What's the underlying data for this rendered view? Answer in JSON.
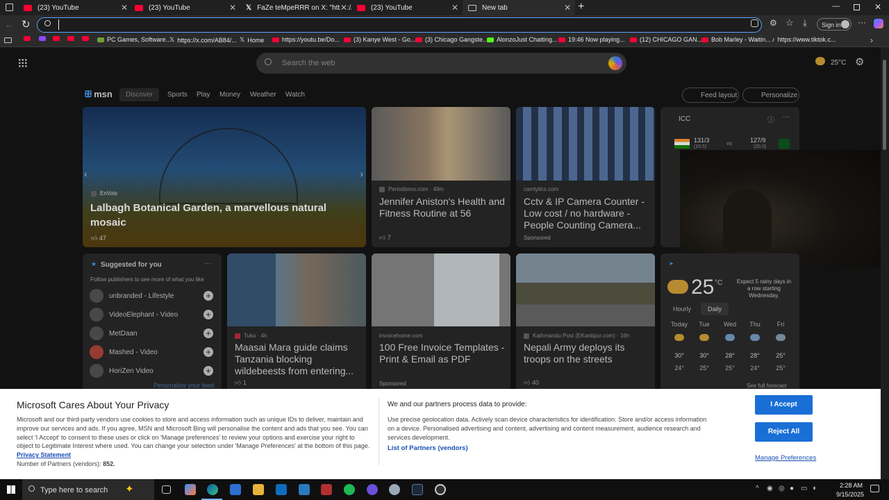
{
  "tabs": [
    {
      "title": "(23) YouTube",
      "icon": "youtube-icon"
    },
    {
      "title": "(23) YouTube",
      "icon": "youtube-icon"
    },
    {
      "title": "FaZe teMpeRRR on X: \"https://t.c",
      "icon": "x-icon"
    },
    {
      "title": "(23) YouTube",
      "icon": "youtube-icon"
    },
    {
      "title": "New tab",
      "icon": "newtab-icon"
    }
  ],
  "address": {
    "value": "",
    "placeholder": ""
  },
  "bookmarks": [
    "PC Games, Software...",
    "https://x.com/AB84/...",
    "Home",
    "https://youtu.be/Do...",
    "(3) Kanye West - Go...",
    "(3) Chicago Gangste...",
    "AlonzoJust Chatting...",
    "19:46 Now playing...",
    "(12) CHICAGO GAN...",
    "Bob Marley - Waitin...",
    "https://www.tiktok.c..."
  ],
  "msn": {
    "search_placeholder": "Search the web",
    "temp": "25°C",
    "logo": "msn",
    "nav": [
      "Discover",
      "Sports",
      "Play",
      "Money",
      "Weather",
      "Watch"
    ],
    "feed_layout": "Feed layout",
    "personalize": "Personalize",
    "hero": {
      "source": "EnVols",
      "title": "Lalbagh Botanical Garden, a marvellous natural mosaic",
      "likes": "47"
    },
    "card1": {
      "source": "Periodismo.com · 49m",
      "title": "Jennifer Aniston's Health and Fitness Routine at 56",
      "likes": "7"
    },
    "card2": {
      "source": "camlytics.com",
      "title": "Cctv & IP Camera Counter - Low cost / no hardware - People Counting Camera...",
      "sponsored": "Sponsored"
    },
    "icc": {
      "label": "ICC",
      "team1_score": "131/3",
      "team1_overs": "(15.5)",
      "vs": "vs",
      "team2_score": "127/9",
      "team2_overs": "(20.0)"
    },
    "suggested": {
      "title": "Suggested for you",
      "subtitle": "Follow publishers to see more of what you like",
      "items": [
        "unbranded - Lifestyle",
        "VideoElephant - Video",
        "MetDaan",
        "Mashed - Video",
        "HoriZen Video"
      ],
      "footer": "Personalize your feed"
    },
    "card3": {
      "source": "Tuko · 4h",
      "title": "Maasai Mara guide claims Tanzania blocking wildebeests from entering...",
      "likes": "1"
    },
    "card4": {
      "source": "invoicehome.com",
      "title": "100 Free Invoice Templates - Print & Email as PDF",
      "sponsored": "Sponsored"
    },
    "card5": {
      "source": "Kathmandu Post (EKantipur.com) · 16h",
      "title": "Nepali Army deploys its troops on the streets",
      "likes": "40"
    },
    "weather": {
      "temp": "25",
      "unit": "°C",
      "desc": "Expect 5 rainy days in a row starting Wednesday.",
      "tab_hourly": "Hourly",
      "tab_daily": "Daily",
      "days": [
        "Today",
        "Tue",
        "Wed",
        "Thu",
        "Fri"
      ],
      "highs": [
        "30°",
        "30°",
        "28°",
        "28°",
        "25°"
      ],
      "lows": [
        "24°",
        "25°",
        "25°",
        "24°",
        "25°"
      ],
      "forecast_link": "See full forecast"
    }
  },
  "privacy": {
    "title": "Microsoft Cares About Your Privacy",
    "body": "Microsoft and our third-party vendors use cookies to store and access information such as unique IDs to deliver, maintain and improve our services and ads. If you agree, MSN and Microsoft Bing will personalise the content and ads that you see. You can select 'I Accept' to consent to these uses or click on 'Manage preferences' to review your options and exercise your right to object to Legitimate Interest where used. You can change your selection under 'Manage Preferences' at the bottom of this page.",
    "privacy_link_1": "Privacy",
    "privacy_link_2": "Statement",
    "partners_label": "Number of Partners (vendors):",
    "partners_count": "852.",
    "data_title": "We and our partners process data to provide:",
    "data_body": "Use precise geolocation data. Actively scan device characteristics for identification. Store and/or access information on a device. Personalised advertising and content, advertising and content measurement, audience research and services development.",
    "partners_link": "List of Partners (vendors)",
    "accept": "I Accept",
    "reject": "Reject All",
    "manage": "Manage Preferences"
  },
  "taskbar": {
    "search_placeholder": "Type here to search",
    "time": "2:28 AM",
    "date": "9/15/2025"
  },
  "browser": {
    "signin": "Sign in"
  }
}
